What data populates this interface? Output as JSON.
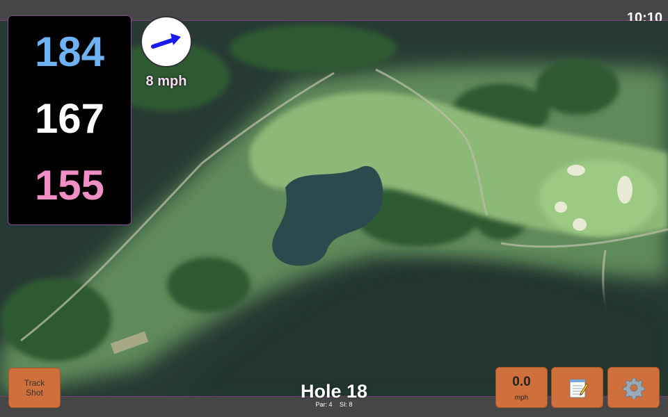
{
  "status": {
    "time": "10:10"
  },
  "distances": {
    "back": "184",
    "middle": "167",
    "front": "155"
  },
  "wind": {
    "speed": "8 mph",
    "icon": "wind-direction-arrow-icon"
  },
  "hole": {
    "title": "Hole 18",
    "par": "Par: 4",
    "stroke_index": "SI: 8"
  },
  "buttons": {
    "track_shot": "Track\nShot",
    "speed_value": "0.0",
    "speed_unit": "mph",
    "notes_icon": "notepad-icon",
    "settings_icon": "gear-icon"
  },
  "colors": {
    "back_distance": "#6eb2f2",
    "middle_distance": "#ffffff",
    "front_distance": "#f08fc6",
    "button": "#cf6f3c",
    "wind_arrow": "#1a1aee"
  }
}
